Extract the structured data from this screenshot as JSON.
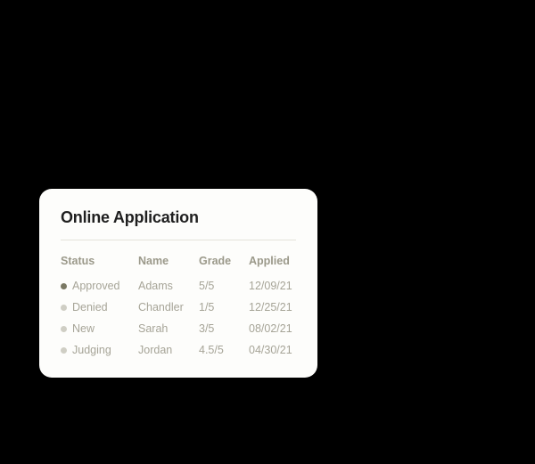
{
  "card": {
    "title": "Online Application"
  },
  "table": {
    "headers": {
      "status": "Status",
      "name": "Name",
      "grade": "Grade",
      "applied": "Applied"
    },
    "rows": [
      {
        "status": "Approved",
        "name": "Adams",
        "grade": "5/5",
        "applied": "12/09/21",
        "dot": "approved"
      },
      {
        "status": "Denied",
        "name": "Chandler",
        "grade": "1/5",
        "applied": "12/25/21",
        "dot": "muted"
      },
      {
        "status": "New",
        "name": "Sarah",
        "grade": "3/5",
        "applied": "08/02/21",
        "dot": "muted"
      },
      {
        "status": "Judging",
        "name": "Jordan",
        "grade": "4.5/5",
        "applied": "04/30/21",
        "dot": "muted"
      }
    ]
  }
}
